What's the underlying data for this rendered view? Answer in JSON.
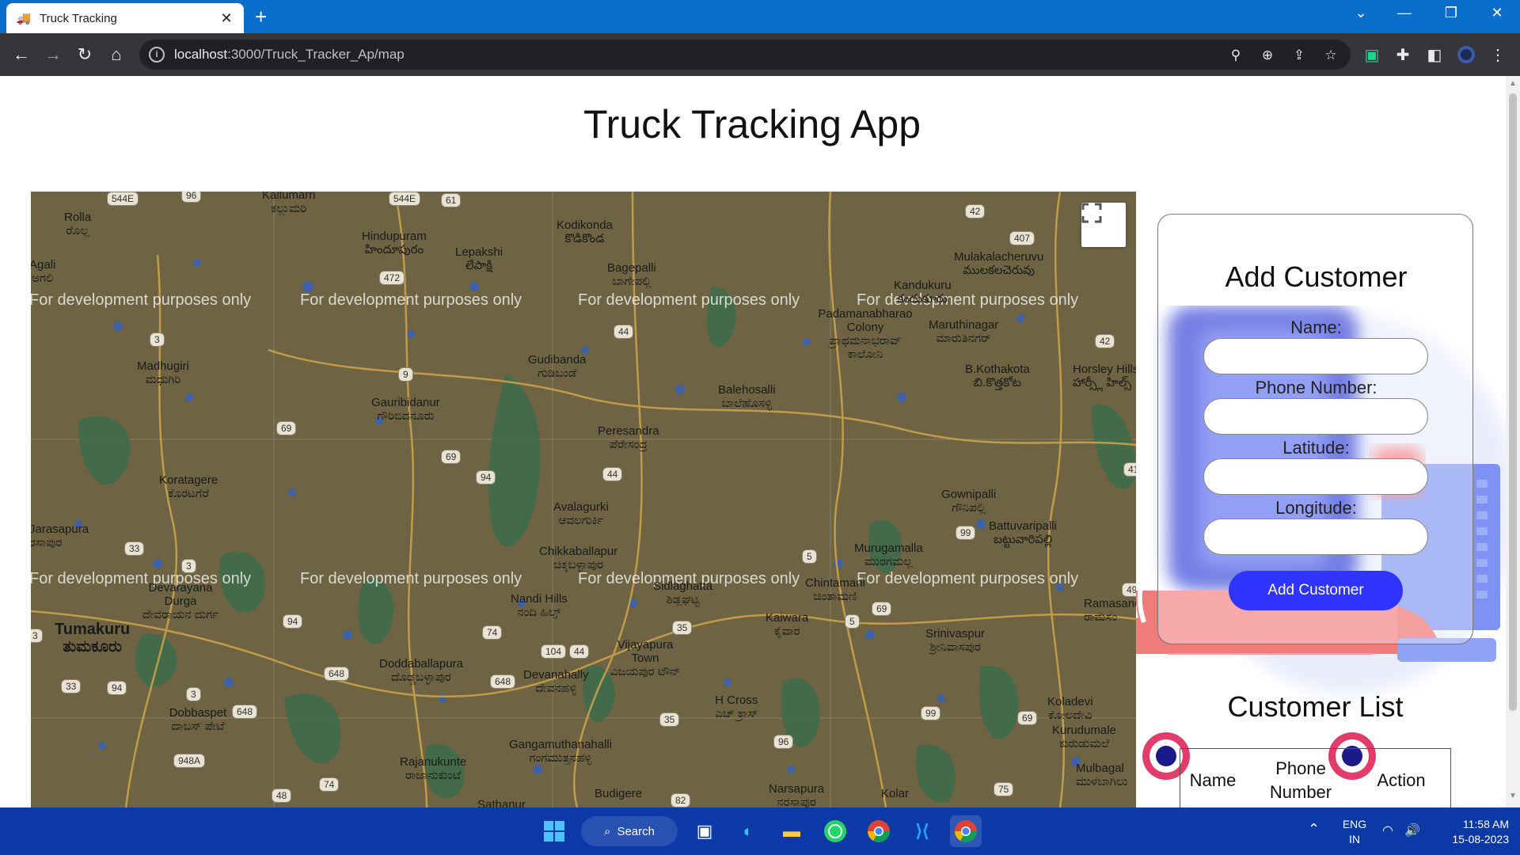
{
  "browser": {
    "tab_title": "Truck Tracking",
    "tab_close": "✕",
    "new_tab": "+",
    "url_host": "localhost",
    "url_path": ":3000/Truck_Tracker_Ap/map",
    "icons": [
      "back-icon",
      "forward-icon",
      "reload-icon",
      "home-icon",
      "location-icon",
      "zoom-icon",
      "share-icon",
      "star-icon",
      "extension-icon",
      "puzzle-icon",
      "sidepanel-icon",
      "profile-icon",
      "menu-icon"
    ]
  },
  "page": {
    "title": "Truck Tracking App"
  },
  "map": {
    "watermark": "For development purposes only",
    "places": [
      {
        "name": "Rolla",
        "local": "ರೊಲ್ಲ"
      },
      {
        "name": "Kallumarri",
        "local": "ಕಲ್ಲುಮರಿ"
      },
      {
        "name": "Hindupuram",
        "local": "హిందూపురం"
      },
      {
        "name": "Lepakshi",
        "local": "లేపాక్షి"
      },
      {
        "name": "Kodikonda",
        "local": "కొడికొండ"
      },
      {
        "name": "Bagepalli",
        "local": "ಬಾಗೇಪಲ್ಲಿ"
      },
      {
        "name": "Mulakalacheruvu",
        "local": "ములకలచెరువు"
      },
      {
        "name": "Kandukuru",
        "local": "కందుకూరు"
      },
      {
        "name": "Padamanabharao Colony",
        "local": "ಪ್ರಾಥಮನಾಭರಾವ್ ಕಾಲೋನಿ"
      },
      {
        "name": "Maruthinagar",
        "local": "ಮಾರುತಿನಗರ್"
      },
      {
        "name": "Agali",
        "local": "ಅಗಲಿ"
      },
      {
        "name": "Madhugiri",
        "local": "ಮಧುಗಿರಿ"
      },
      {
        "name": "Gauribidanur",
        "local": "ಗೌರಿಬಿದನೂರು"
      },
      {
        "name": "Gudibanda",
        "local": "ಗುಡಿಬಂಡೆ"
      },
      {
        "name": "Balehosalli",
        "local": "ಬಾಲೆಹೊಸಳ್ಳಿ"
      },
      {
        "name": "B.Kothakota",
        "local": "బి.కొత్తకోట"
      },
      {
        "name": "Horsley Hills",
        "local": "హార్స్లీ హిల్స్"
      },
      {
        "name": "Peresandra",
        "local": "ಪೆರೇಸಂದ್ರ"
      },
      {
        "name": "Koratagere",
        "local": "ಕೊರಟಗೆರೆ"
      },
      {
        "name": "Avalagurki",
        "local": "ಆವಲಗುರ್ಕಿ"
      },
      {
        "name": "Gownipalli",
        "local": "ಗೌನಿಪಲ್ಲಿ"
      },
      {
        "name": "Battuvaripalli",
        "local": "బట్టువారిపల్లి"
      },
      {
        "name": "Chikkaballapur",
        "local": "ಚಿಕ್ಕಬಳ್ಳಾಪುರ"
      },
      {
        "name": "Murugamalla",
        "local": "ಮುರಗಮಲ್ಲ"
      },
      {
        "name": "Devarayana Durga",
        "local": "ದೇವರಾಯನ ದುರ್ಗ"
      },
      {
        "name": "Sidlaghatta",
        "local": "ಶಿಡ್ಲಘಟ್ಟ"
      },
      {
        "name": "Chintamani",
        "local": "ಚಿಂತಾಮಣಿ"
      },
      {
        "name": "Nandi Hills",
        "local": "ನಂದಿ ಹಿಲ್ಸ್"
      },
      {
        "name": "Tumakuru",
        "local": "ತುಮಕೂರು"
      },
      {
        "name": "Kaiwara",
        "local": "ಕೈವಾರ"
      },
      {
        "name": "Ramasandra",
        "local": "ರಾಮಸಂ"
      },
      {
        "name": "Srinivaspur",
        "local": "ಶ್ರೀನಿವಾಸಪುರ"
      },
      {
        "name": "Vijayapura Town",
        "local": "ವಿಜಯಪುರ ಟೌನ್"
      },
      {
        "name": "Doddaballapura",
        "local": "ದೊಡ್ಡಬಳ್ಳಾಪುರ"
      },
      {
        "name": "Devanahally",
        "local": "ದೇವನಹಳ್ಳಿ"
      },
      {
        "name": "Dobbaspet",
        "local": "ದಾಬಸ್ ಪೇಟೆ"
      },
      {
        "name": "H Cross",
        "local": "ಎಚ್ ಕ್ರಾಸ್"
      },
      {
        "name": "Koladevi",
        "local": "ಕೋಲದೇವಿ"
      },
      {
        "name": "Kurudumale",
        "local": "ಕುರುಡುಮಲೆ"
      },
      {
        "name": "Gangamuthanahalli",
        "local": "ಗಂಗಮುತ್ತನಹಳ್ಳಿ"
      },
      {
        "name": "Rajanukunte",
        "local": "ರಾಜಾನುಕುಂಟೆ"
      },
      {
        "name": "Mulbagal",
        "local": "ಮುಳಬಾಗಿಲು"
      },
      {
        "name": "Narsapura",
        "local": "ನರಸಾಪುರ"
      },
      {
        "name": "Kolar",
        "local": ""
      },
      {
        "name": "Budigere",
        "local": ""
      },
      {
        "name": "Sathanur",
        "local": ""
      },
      {
        "name": "Jarasapura",
        "local": "ರಸಾಪುರ"
      }
    ],
    "shields": [
      "544E",
      "96",
      "544E",
      "61",
      "42",
      "407",
      "472",
      "3",
      "44",
      "42",
      "9",
      "69",
      "69",
      "94",
      "44",
      "41",
      "33",
      "3",
      "99",
      "5",
      "94",
      "74",
      "104",
      "44",
      "35",
      "5",
      "69",
      "648",
      "648",
      "3",
      "33",
      "94",
      "3",
      "648",
      "948A",
      "35",
      "99",
      "69",
      "96",
      "74",
      "48",
      "82",
      "75",
      "49",
      "69"
    ]
  },
  "form": {
    "title": "Add Customer",
    "name_label": "Name:",
    "phone_label": "Phone Number:",
    "lat_label": "Latitude:",
    "lng_label": "Longitude:",
    "submit_label": "Add Customer"
  },
  "customer_list": {
    "title": "Customer List",
    "columns": [
      "Name",
      "Phone Number",
      "Action"
    ]
  },
  "taskbar": {
    "search_label": "Search",
    "lang_1": "ENG",
    "lang_2": "IN",
    "time": "11:58 AM",
    "date": "15-08-2023"
  },
  "colors": {
    "tab_bar": "#0a6fcc",
    "map_bg": "#6e6342",
    "primary_button": "#2f35ff",
    "taskbar": "#0b3aa8"
  }
}
